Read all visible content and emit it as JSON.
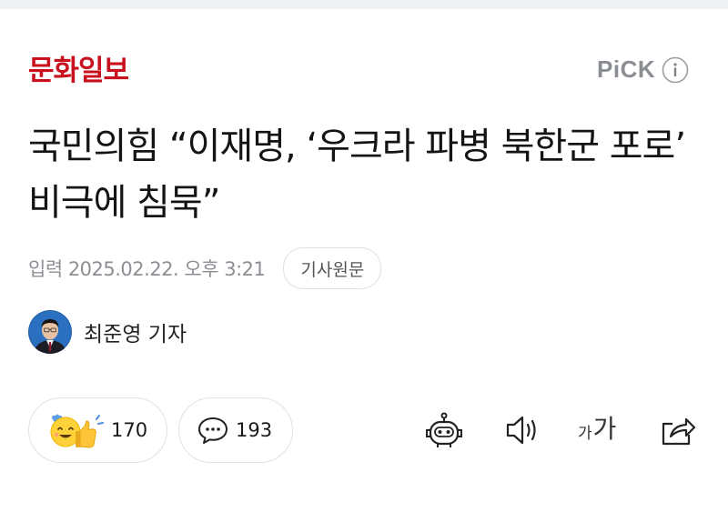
{
  "press": {
    "name": "문화일보"
  },
  "pick": {
    "label": "PiCK"
  },
  "article": {
    "headline": "국민의힘 “이재명, ‘우크라 파병 북한군 포로’ 비극에 침묵”",
    "datetime": "입력 2025.02.22. 오후 3:21",
    "original_button": "기사원문"
  },
  "reporter": {
    "name": "최준영 기자"
  },
  "actions": {
    "reaction_count": "170",
    "comment_count": "193"
  },
  "font_button": {
    "small": "가",
    "large": "가"
  },
  "colors": {
    "brand": "#c8101e",
    "muted": "#8c8f94",
    "border": "#dfe2e6"
  }
}
